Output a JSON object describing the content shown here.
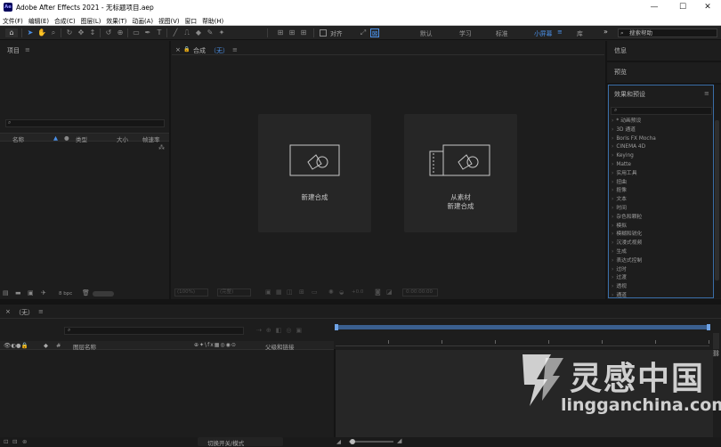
{
  "window": {
    "logo_text": "Ae",
    "title": "Adobe After Effects 2021 - 无标题项目.aep",
    "minimize": "—",
    "maximize": "☐",
    "close": "✕"
  },
  "menu": [
    "文件(F)",
    "编辑(E)",
    "合成(C)",
    "图层(L)",
    "效果(T)",
    "动画(A)",
    "视图(V)",
    "窗口",
    "帮助(H)"
  ],
  "toolbar": {
    "snap_label": "对齐",
    "workspaces": [
      "默认",
      "学习",
      "标准",
      "小屏幕",
      "库"
    ],
    "active_workspace": "小屏幕",
    "more": "»",
    "search_placeholder": "搜索帮助"
  },
  "project_panel": {
    "title": "项目",
    "columns": [
      "名称",
      "类型",
      "大小",
      "帧速率"
    ],
    "bpc": "8 bpc"
  },
  "comp_panel": {
    "title": "合成",
    "comp_name": "（无）",
    "new_comp_label": "新建合成",
    "from_footage_line1": "从素材",
    "from_footage_line2": "新建合成",
    "zoom_value": "(100%)",
    "quality_value": "(完整)",
    "exposure_value": "+0.0",
    "timecode": "0:00:00:00"
  },
  "right_panels": {
    "info_title": "信息",
    "preview_title": "预览",
    "effects_title": "效果和预设",
    "effects_items": [
      "* 动画预设",
      "3D 通道",
      "Boris FX Mocha",
      "CINEMA 4D",
      "Keying",
      "Matte",
      "实用工具",
      "扭曲",
      "抠像",
      "文本",
      "时间",
      "杂色和颗粒",
      "模拟",
      "模糊和锐化",
      "沉浸式视频",
      "生成",
      "表达式控制",
      "过时",
      "过渡",
      "透视",
      "通道"
    ]
  },
  "timeline": {
    "title": "（无）",
    "layer_name_col": "图层名称",
    "parent_col": "父级和链接",
    "toggle_label": "切换开关/模式"
  },
  "watermark": {
    "cn": "灵感中国",
    "url": "lingganchina.com"
  }
}
